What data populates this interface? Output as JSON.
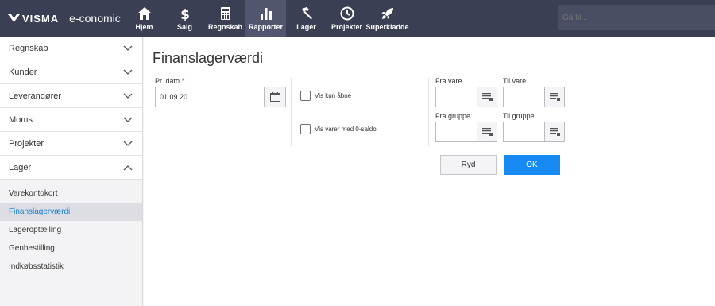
{
  "brand": {
    "name": "VISMA",
    "product": "e-conomic"
  },
  "nav": [
    {
      "label": "Hjem",
      "icon": "home-icon"
    },
    {
      "label": "Salg",
      "icon": "dollar-icon"
    },
    {
      "label": "Regnskab",
      "icon": "calculator-icon"
    },
    {
      "label": "Rapporter",
      "icon": "bar-chart-icon",
      "active": true
    },
    {
      "label": "Lager",
      "icon": "hammer-icon"
    },
    {
      "label": "Projekter",
      "icon": "clock-icon"
    },
    {
      "label": "Superkladde",
      "icon": "rocket-icon"
    }
  ],
  "search": {
    "placeholder": "Gå til..."
  },
  "sidebar": {
    "groups": [
      {
        "label": "Regnskab",
        "state": "collapsed"
      },
      {
        "label": "Kunder",
        "state": "collapsed"
      },
      {
        "label": "Leverandører",
        "state": "collapsed"
      },
      {
        "label": "Moms",
        "state": "collapsed"
      },
      {
        "label": "Projekter",
        "state": "collapsed"
      },
      {
        "label": "Lager",
        "state": "expanded"
      }
    ],
    "sub_items": [
      {
        "label": "Varekontokort"
      },
      {
        "label": "Finanslagerværdi",
        "active": true
      },
      {
        "label": "Lageroptælling"
      },
      {
        "label": "Genbestilling"
      },
      {
        "label": "Indkøbsstatistik"
      }
    ]
  },
  "main": {
    "title": "Finanslagerværdi",
    "date_label": "Pr. dato",
    "required_mark": "*",
    "date_value": "01.09.20",
    "checkbox_open": "Vis kun åbne",
    "checkbox_zero": "Vis varer med 0-saldo",
    "fra_vare": "Fra vare",
    "til_vare": "Til vare",
    "fra_gruppe": "Fra gruppe",
    "til_gruppe": "Til gruppe",
    "btn_reset": "Ryd",
    "btn_ok": "OK"
  },
  "colors": {
    "topbar": "#3b3f54",
    "accent": "#1689f2",
    "active_link": "#1a7fd2"
  }
}
